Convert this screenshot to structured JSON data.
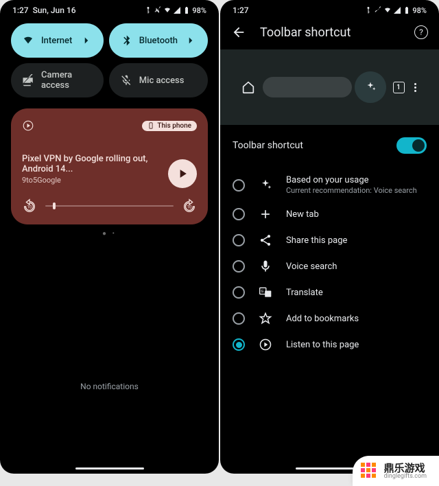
{
  "left": {
    "status": {
      "time": "1:27",
      "date": "Sun, Jun 16",
      "battery": "98%"
    },
    "tiles": [
      {
        "label": "Internet",
        "state": "on"
      },
      {
        "label": "Bluetooth",
        "state": "on"
      },
      {
        "label": "Camera access",
        "state": "off"
      },
      {
        "label": "Mic access",
        "state": "off"
      }
    ],
    "media": {
      "device_chip": "This phone",
      "title": "Pixel VPN by Google rolling out, Android 14...",
      "source": "9to5Google"
    },
    "no_notifications": "No notifications"
  },
  "right": {
    "status": {
      "time": "1:27",
      "battery": "98%"
    },
    "header": {
      "title": "Toolbar shortcut"
    },
    "preview": {
      "tab_count": "1"
    },
    "toggle": {
      "label": "Toolbar shortcut",
      "on": true
    },
    "options": [
      {
        "label": "Based on your usage",
        "sub": "Current recommendation:  Voice search",
        "icon": "sparkle",
        "selected": false
      },
      {
        "label": "New tab",
        "icon": "plus",
        "selected": false
      },
      {
        "label": "Share this page",
        "icon": "share",
        "selected": false
      },
      {
        "label": "Voice search",
        "icon": "mic",
        "selected": false
      },
      {
        "label": "Translate",
        "icon": "translate",
        "selected": false
      },
      {
        "label": "Add to bookmarks",
        "icon": "star",
        "selected": false
      },
      {
        "label": "Listen to this page",
        "icon": "play-circle",
        "selected": true
      }
    ]
  },
  "watermark": {
    "cn": "鼎乐游戏",
    "url": "dinglegifts.com"
  }
}
